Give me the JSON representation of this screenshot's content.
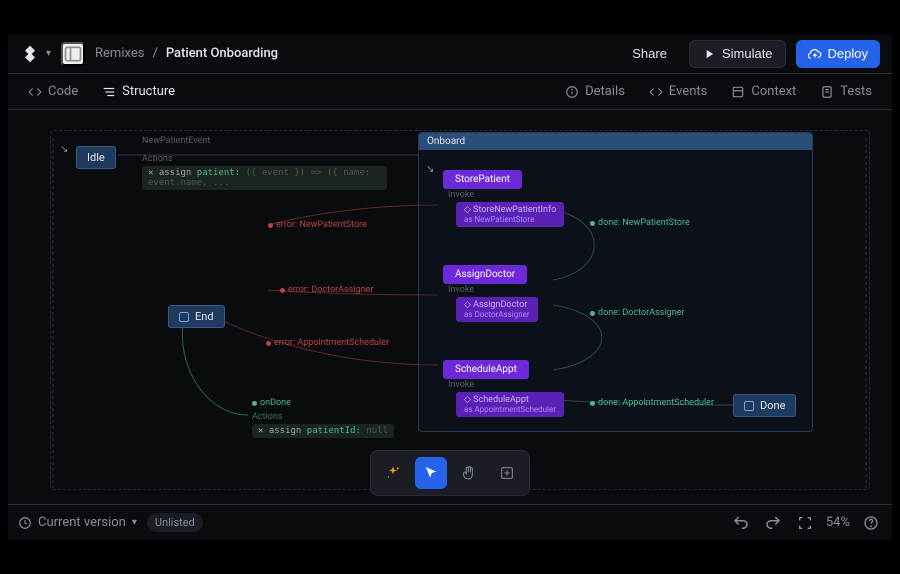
{
  "breadcrumb": {
    "parent": "Remixes",
    "sep": "/",
    "current": "Patient Onboarding"
  },
  "topbar": {
    "share": "Share",
    "simulate": "Simulate",
    "deploy": "Deploy"
  },
  "subtabs": {
    "left": {
      "code": "Code",
      "structure": "Structure"
    },
    "right": {
      "details": "Details",
      "events": "Events",
      "context": "Context",
      "tests": "Tests"
    }
  },
  "canvas": {
    "idle_state": "Idle",
    "end_state": "End",
    "done_state": "Done",
    "event_new_patient": "NewPatientEvent",
    "actions_label": "Actions",
    "invoke_label": "Invoke",
    "initial_assign": {
      "kw": "assign",
      "key": "patient:",
      "expr": "({ event }) => ({ name: event.name, ..."
    },
    "onboard_container": "Onboard",
    "states": {
      "store_patient": {
        "name": "StorePatient",
        "invoke_name": "StoreNewPatientInfo",
        "invoke_as": "as NewPatientStore",
        "error": "error: NewPatientStore",
        "done": "done: NewPatientStore"
      },
      "assign_doctor": {
        "name": "AssignDoctor",
        "invoke_name": "AssignDoctor",
        "invoke_as": "as DoctorAssigner",
        "error": "error: DoctorAssigner",
        "done": "done: DoctorAssigner"
      },
      "schedule_appt": {
        "name": "ScheduleAppt",
        "invoke_name": "ScheduleAppt",
        "invoke_as": "as AppointmentScheduler",
        "error": "error: AppointmentScheduler",
        "done": "done: AppointmentScheduler"
      }
    },
    "on_done": {
      "label": "onDone",
      "actions": "Actions",
      "assign_kw": "assign",
      "assign_key": "patientId:",
      "assign_expr": "null"
    }
  },
  "statusbar": {
    "version": "Current version",
    "badge": "Unlisted",
    "zoom": "54%"
  },
  "colors": {
    "accent": "#2563eb",
    "purple": "#6d28d9",
    "error": "#b94444",
    "done": "#4db894"
  }
}
